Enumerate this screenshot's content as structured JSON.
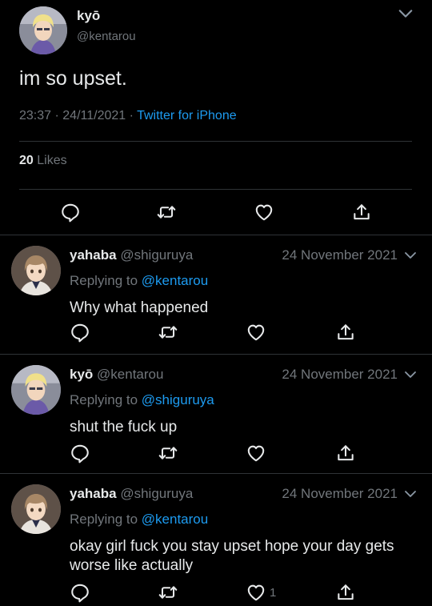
{
  "main_tweet": {
    "display_name": "kyō",
    "handle": "@kentarou",
    "text": "im so upset.",
    "time": "23:37",
    "date": "24/11/2021",
    "source": "Twitter for iPhone",
    "likes_count": "20",
    "likes_label": "Likes"
  },
  "replies": [
    {
      "display_name": "yahaba",
      "handle": "@shiguruya",
      "date": "24 November 2021",
      "replying_label": "Replying to",
      "replying_to": "@kentarou",
      "text": "Why what happened",
      "like_count": ""
    },
    {
      "display_name": "kyō",
      "handle": "@kentarou",
      "date": "24 November 2021",
      "replying_label": "Replying to",
      "replying_to": "@shiguruya",
      "text": "shut the fuck up",
      "like_count": ""
    },
    {
      "display_name": "yahaba",
      "handle": "@shiguruya",
      "date": "24 November 2021",
      "replying_label": "Replying to",
      "replying_to": "@kentarou",
      "text": "okay girl fuck you stay upset hope your day gets worse like actually",
      "like_count": "1"
    }
  ],
  "icons": {
    "reply": "speech-bubble-icon",
    "retweet": "retweet-icon",
    "like": "heart-icon",
    "share": "share-icon",
    "more": "chevron-down-icon"
  },
  "colors": {
    "background": "#000000",
    "text": "#e7e9ea",
    "secondary": "#71767b",
    "link": "#1d9bf0",
    "divider": "#2f3336"
  }
}
